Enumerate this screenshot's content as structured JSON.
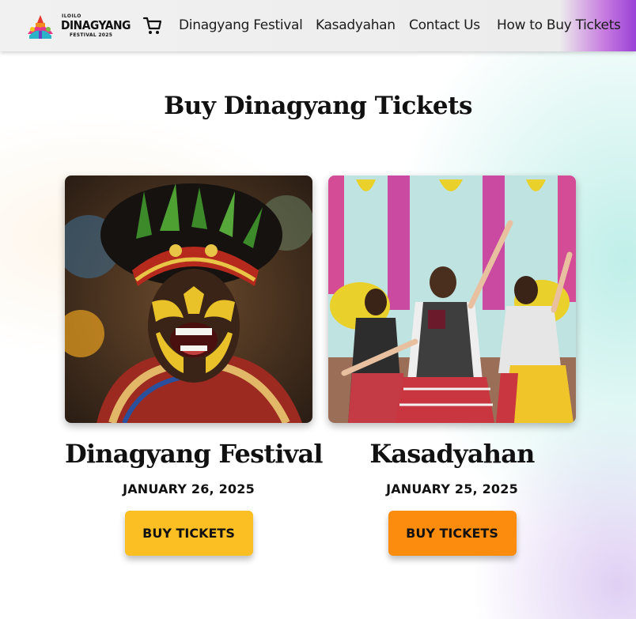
{
  "brand": {
    "logo_top": "ILOILO",
    "logo_main": "DINAGYANG",
    "logo_sub": "FESTIVAL 2025"
  },
  "nav": {
    "links": [
      "Dinagyang Festival",
      "Kasadyahan",
      "Contact Us",
      "How to Buy Tickets"
    ],
    "cart_icon": "shopping-cart-icon"
  },
  "page": {
    "title": "Buy Dinagyang Tickets"
  },
  "events": [
    {
      "name": "Dinagyang Festival",
      "date": "JANUARY 26, 2025",
      "button_label": "BUY TICKETS",
      "button_color": "#fbbf24",
      "image": "festival-performer-photo"
    },
    {
      "name": "Kasadyahan",
      "date": "JANUARY 25, 2025",
      "button_label": "BUY TICKETS",
      "button_color": "#fb8c0e",
      "image": "kasadyahan-dancers-photo"
    }
  ],
  "colors": {
    "nav_accent": "#9a42d6",
    "text": "#111111"
  }
}
